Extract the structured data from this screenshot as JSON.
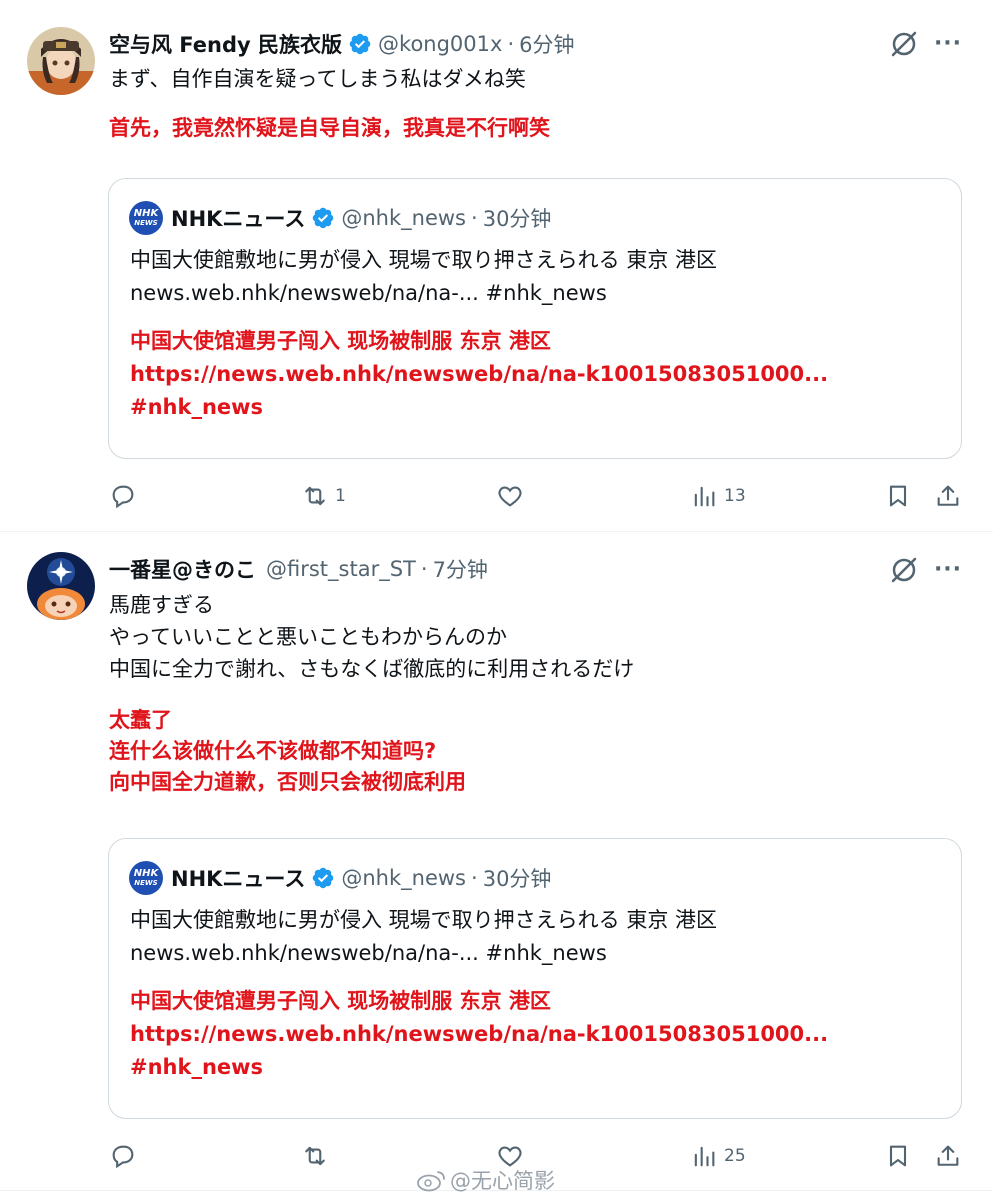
{
  "tweets": [
    {
      "author_name": "空与风 Fendy 民族衣版",
      "handle": "@kong001x",
      "time": "6分钟",
      "text_lines": [
        "まず、自作自演を疑ってしまう私はダメね笑"
      ],
      "translation_lines": [
        "首先，我竟然怀疑是自导自演，我真是不行啊笑"
      ],
      "quote": {
        "author_name": "NHKニュース",
        "handle": "@nhk_news",
        "time": "30分钟",
        "logo_text": [
          "NHK",
          "NEWS"
        ],
        "text_lines": [
          "中国大使館敷地に男が侵入 現場で取り押さえられる 東京 港区",
          "news.web.nhk/newsweb/na/na-... #nhk_news"
        ],
        "translation_lines": [
          "中国大使馆遭男子闯入 现场被制服 东京 港区",
          "https://news.web.nhk/newsweb/na/na-k10015083051000...",
          "#nhk_news"
        ]
      },
      "stats": {
        "replies": "",
        "reposts": "1",
        "likes": "",
        "views": "13"
      }
    },
    {
      "author_name": "一番星@きのこ",
      "handle": "@first_star_ST",
      "time": "7分钟",
      "text_lines": [
        "馬鹿すぎる",
        "やっていいことと悪いこともわからんのか",
        "中国に全力で謝れ、さもなくば徹底的に利用されるだけ"
      ],
      "translation_lines": [
        "太蠢了",
        "连什么该做什么不该做都不知道吗?",
        "向中国全力道歉，否则只会被彻底利用"
      ],
      "quote": {
        "author_name": "NHKニュース",
        "handle": "@nhk_news",
        "time": "30分钟",
        "logo_text": [
          "NHK",
          "NEWS"
        ],
        "text_lines": [
          "中国大使館敷地に男が侵入 現場で取り押さえられる 東京 港区",
          "news.web.nhk/newsweb/na/na-... #nhk_news"
        ],
        "translation_lines": [
          "中国大使馆遭男子闯入 现场被制服 东京 港区",
          "https://news.web.nhk/newsweb/na/na-k10015083051000...",
          "#nhk_news"
        ]
      },
      "stats": {
        "replies": "",
        "reposts": "",
        "likes": "",
        "views": "25"
      }
    }
  ],
  "header_separator": "·",
  "more_glyph": "···",
  "watermark": "@无心简影",
  "colors": {
    "translation": "#e0141b",
    "verified": "#1d9bf0",
    "muted": "#536471",
    "border": "#cfd9de"
  },
  "icons": [
    "verified-badge-icon",
    "grok-icon",
    "more-icon",
    "reply-icon",
    "repost-icon",
    "like-icon",
    "views-icon",
    "bookmark-icon",
    "share-icon"
  ]
}
